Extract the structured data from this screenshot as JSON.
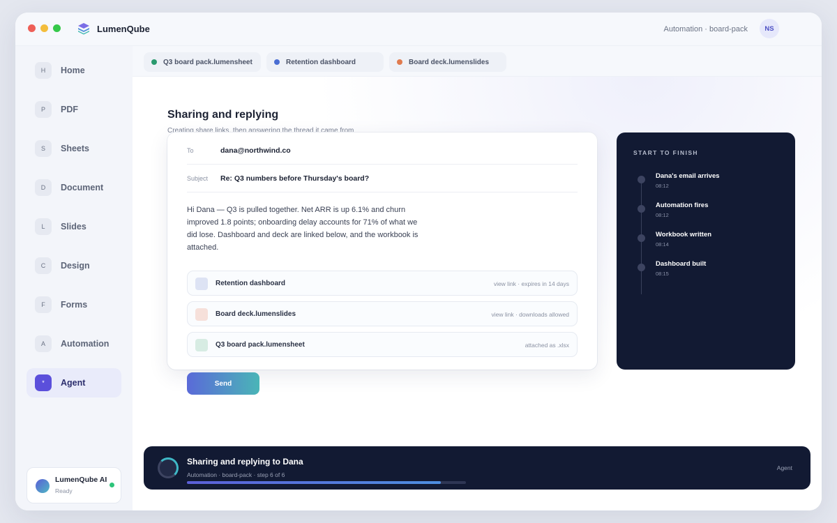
{
  "app": {
    "name": "LumenQube",
    "breadcrumb": "Automation · board-pack",
    "user_initials": "NS"
  },
  "sidebar": {
    "items": [
      {
        "key": "H",
        "label": "Home"
      },
      {
        "key": "P",
        "label": "PDF"
      },
      {
        "key": "S",
        "label": "Sheets"
      },
      {
        "key": "D",
        "label": "Document"
      },
      {
        "key": "L",
        "label": "Slides"
      },
      {
        "key": "C",
        "label": "Design"
      },
      {
        "key": "F",
        "label": "Forms"
      },
      {
        "key": "A",
        "label": "Automation"
      },
      {
        "key": "*",
        "label": "Agent",
        "active": true
      }
    ],
    "assistant": {
      "name": "LumenQube AI",
      "status": "Ready"
    }
  },
  "tabs": [
    {
      "label": "Q3 board pack.lumensheet",
      "color": "#2a9a6e"
    },
    {
      "label": "Retention dashboard",
      "color": "#4a6ed3"
    },
    {
      "label": "Board deck.lumenslides",
      "color": "#e07b4f"
    }
  ],
  "page": {
    "title": "Sharing and replying",
    "subtitle": "Creating share links, then answering the thread it came from"
  },
  "email": {
    "to_label": "To",
    "to": "dana@northwind.co",
    "subject_label": "Subject",
    "subject": "Re: Q3 numbers before Thursday's board?",
    "body": "Hi Dana — Q3 is pulled together. Net ARR is up 6.1% and churn improved 1.8 points; onboarding delay accounts for 71% of what we did lose. Dashboard and deck are linked below, and the workbook is attached.",
    "attachments": [
      {
        "name": "Retention dashboard",
        "meta": "view link · expires in 14 days",
        "color": "#dde3f4"
      },
      {
        "name": "Board deck.lumenslides",
        "meta": "view link · downloads allowed",
        "color": "#f6e0da"
      },
      {
        "name": "Q3 board pack.lumensheet",
        "meta": "attached as .xlsx",
        "color": "#d7ece3"
      }
    ],
    "send_label": "Send"
  },
  "timeline": {
    "title": "START TO FINISH",
    "steps": [
      {
        "label": "Dana's email arrives",
        "time": "08:12"
      },
      {
        "label": "Automation fires",
        "time": "08:12"
      },
      {
        "label": "Workbook written",
        "time": "08:14"
      },
      {
        "label": "Dashboard built",
        "time": "08:15"
      }
    ]
  },
  "task": {
    "title": "Sharing and replying to Dana",
    "meta": "Automation · board-pack · step 6 of 6",
    "progress": 0.91,
    "agent_label": "Agent"
  }
}
